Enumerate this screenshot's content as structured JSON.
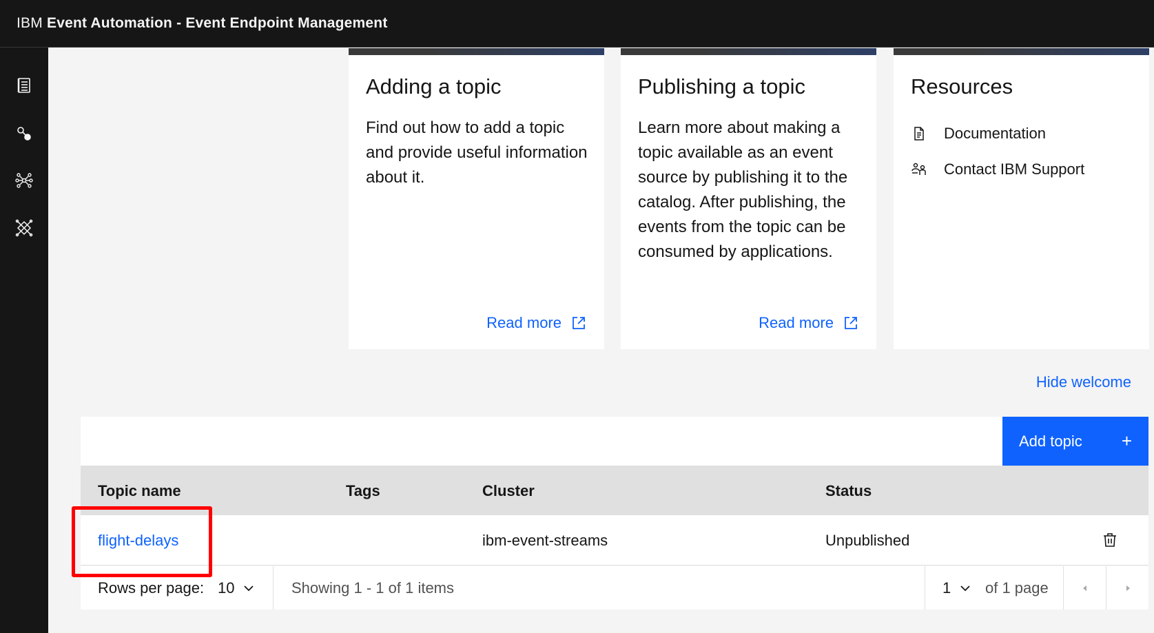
{
  "header": {
    "brand_prefix": "IBM",
    "product_name": "Event Automation - Event Endpoint Management"
  },
  "sidenav": {
    "items": [
      {
        "icon": "catalog-icon"
      },
      {
        "icon": "topology-icon"
      },
      {
        "icon": "network-icon"
      },
      {
        "icon": "integration-icon"
      }
    ]
  },
  "cards": {
    "adding": {
      "title": "Adding a topic",
      "body": "Find out how to add a topic and provide useful information about it.",
      "link": "Read more"
    },
    "publishing": {
      "title": "Publishing a topic",
      "body": "Learn more about making a topic available as an event source by publishing it to the catalog. After publishing, the events from the topic can be consumed by applications.",
      "link": "Read more"
    },
    "resources": {
      "title": "Resources",
      "items": [
        {
          "label": "Documentation",
          "icon": "document-icon"
        },
        {
          "label": "Contact IBM Support",
          "icon": "support-icon"
        }
      ]
    }
  },
  "welcome": {
    "hide_label": "Hide welcome"
  },
  "toolbar": {
    "add_label": "Add topic",
    "add_icon": "+"
  },
  "table": {
    "headers": [
      "Topic name",
      "Tags",
      "Cluster",
      "Status"
    ],
    "rows": [
      {
        "topic": "flight-delays",
        "tags": "",
        "cluster": "ibm-event-streams",
        "status": "Unpublished"
      }
    ]
  },
  "pagination": {
    "rows_label": "Rows per page:",
    "rows_value": "10",
    "showing": "Showing 1 - 1 of 1 items",
    "page_value": "1",
    "of_pages": "of 1 page"
  },
  "colors": {
    "accent": "#0f62fe",
    "header_bg": "#161616",
    "highlight": "#ff0000"
  }
}
